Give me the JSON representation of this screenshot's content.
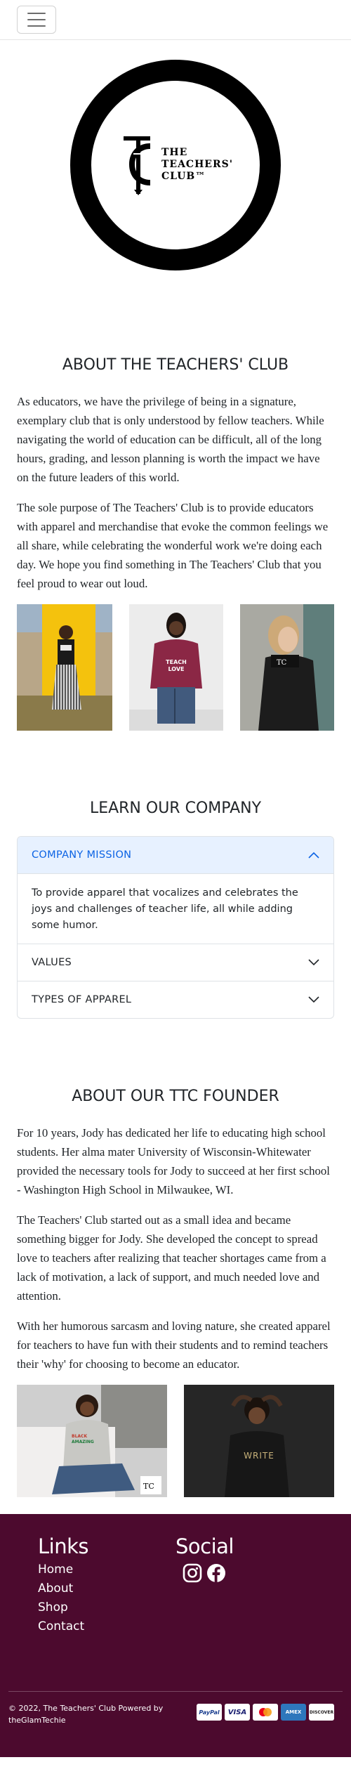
{
  "navbar": {
    "toggle_icon": "hamburger-menu-icon"
  },
  "logo": {
    "line1": "THE",
    "line2": "TEACHERS'",
    "line3": "CLUB™"
  },
  "about": {
    "title": "ABOUT THE TEACHERS' CLUB",
    "p1": "As educators, we have the privilege of being in a signature, exemplary club that is only understood by fellow teachers. While navigating the world of education can be difficult, all of the long hours, grading, and lesson planning is worth the impact we have on the future leaders of this world.",
    "p2": "The sole purpose of The Teachers' Club is to provide educators with apparel and merchandise that evoke the common feelings we all share, while celebrating the wonderful work we're doing each day. We hope you find something in The Teachers' Club that you feel proud to wear out loud.",
    "shirt_text_1": "TEACH",
    "shirt_text_2": "LOVE"
  },
  "learn": {
    "title": "LEARN OUR COMPANY",
    "items": [
      {
        "label": "COMPANY MISSION",
        "body": "To provide apparel that vocalizes and celebrates the joys and challenges of teacher life, all while adding some humor."
      },
      {
        "label": "VALUES"
      },
      {
        "label": "TYPES OF APPAREL"
      }
    ]
  },
  "founder": {
    "title": "ABOUT OUR TTC FOUNDER",
    "p1": "For 10 years, Jody has dedicated her life to educating high school students. Her alma mater University of Wisconsin-Whitewater provided the necessary tools for Jody to succeed at her first school - Washington High School in Milwaukee, WI.",
    "p2": "The Teachers' Club started out as a small idea and became something bigger for Jody. She developed the concept to spread love to teachers after realizing that teacher shortages came from a lack of motivation, a lack of support, and much needed love and attention.",
    "p3": "With her humorous sarcasm and loving nature, she created apparel for teachers to have fun with their students and to remind teachers their 'why' for choosing to become an educator.",
    "shirt_text_1": "BLACK",
    "shirt_text_2": "AMAZING",
    "shirt_text_3": "WRITE"
  },
  "footer": {
    "links_title": "Links",
    "links": [
      "Home",
      "About",
      "Shop",
      "Contact"
    ],
    "social_title": "Social",
    "social_icons": [
      "instagram-icon",
      "facebook-icon"
    ],
    "copyright": "© 2022, The Teachers' Club Powered by theGlamTechie",
    "payment_cards": [
      "PayPal",
      "VISA",
      "mastercard",
      "AMEX",
      "DISCOVER"
    ]
  },
  "colors": {
    "footer_bg": "#4c0a2e",
    "accordion_active_bg": "#e7f1ff",
    "accordion_active_text": "#0c63e4"
  }
}
